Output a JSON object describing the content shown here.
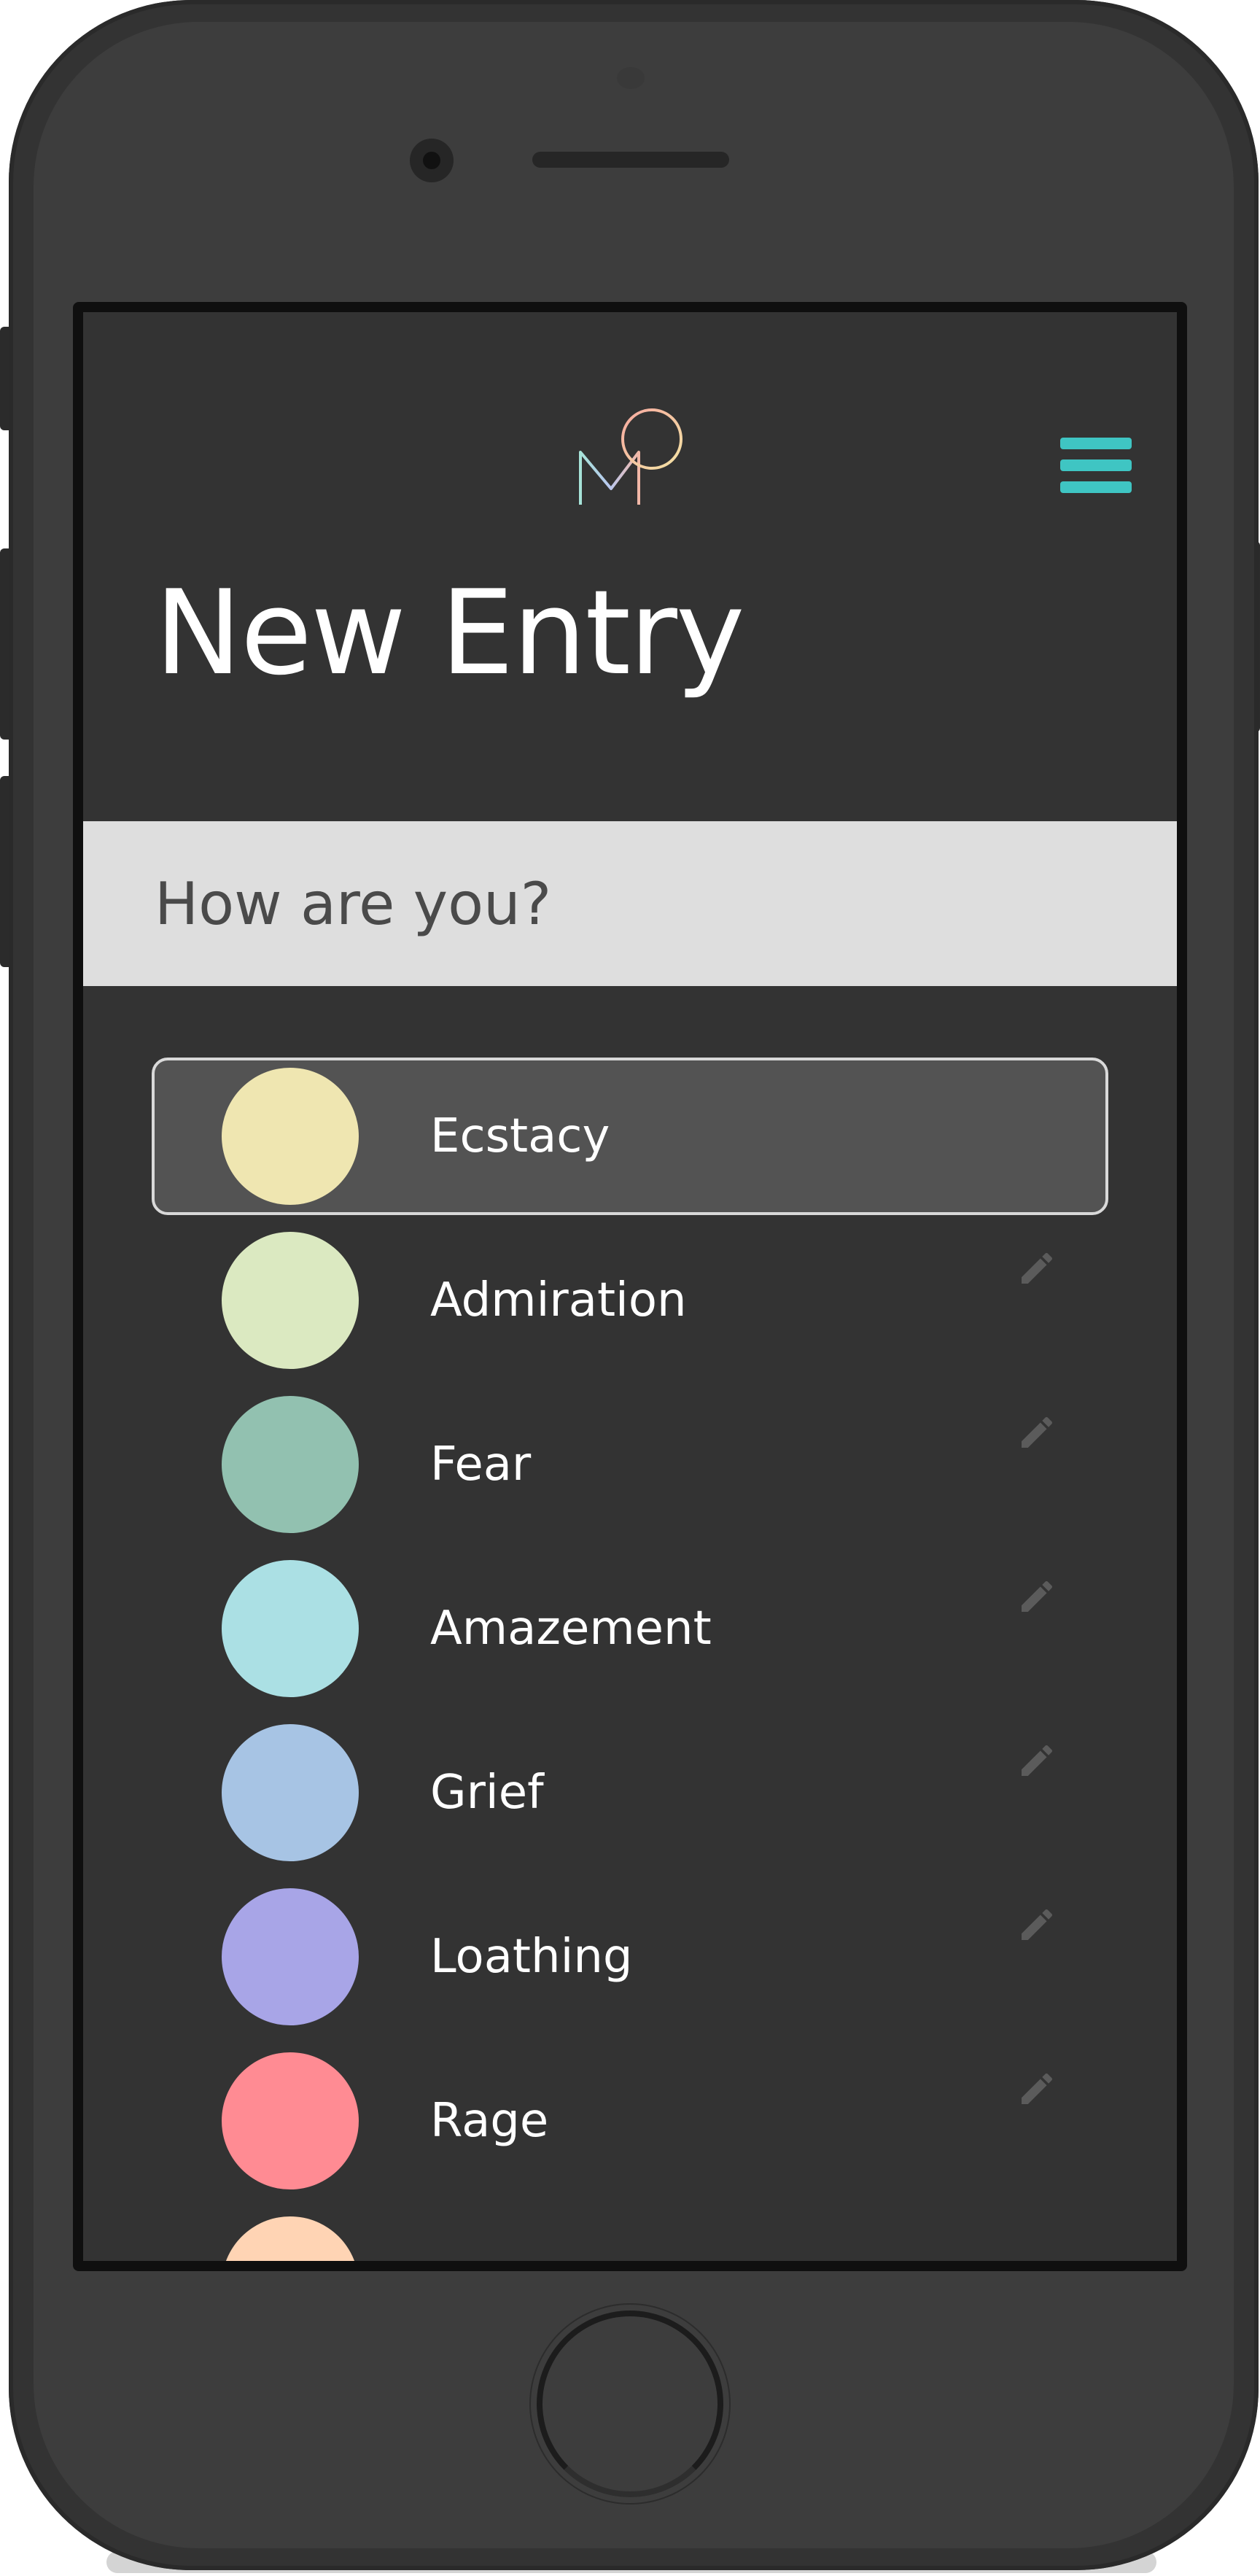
{
  "app": {
    "logo_alt": "M logo"
  },
  "header": {
    "title": "New Entry",
    "menu_icon": "hamburger-menu-icon"
  },
  "prompt": {
    "text": "How are you?"
  },
  "emotions": {
    "selected_index": 0,
    "items": [
      {
        "label": "Ecstacy",
        "color": "#efe6b1"
      },
      {
        "label": "Admiration",
        "color": "#dbe9c1"
      },
      {
        "label": "Fear",
        "color": "#92c1b0"
      },
      {
        "label": "Amazement",
        "color": "#abe0e4"
      },
      {
        "label": "Grief",
        "color": "#a7c4e4"
      },
      {
        "label": "Loathing",
        "color": "#a8a5e7"
      },
      {
        "label": "Rage",
        "color": "#ff8b93"
      },
      {
        "label": "",
        "color": "#ffd4b4"
      }
    ],
    "edit_icon": "pencil-icon"
  },
  "colors": {
    "accent": "#3fc5c3",
    "background": "#333333",
    "prompt_bar": "#dedede",
    "selected_row": "#535353"
  }
}
